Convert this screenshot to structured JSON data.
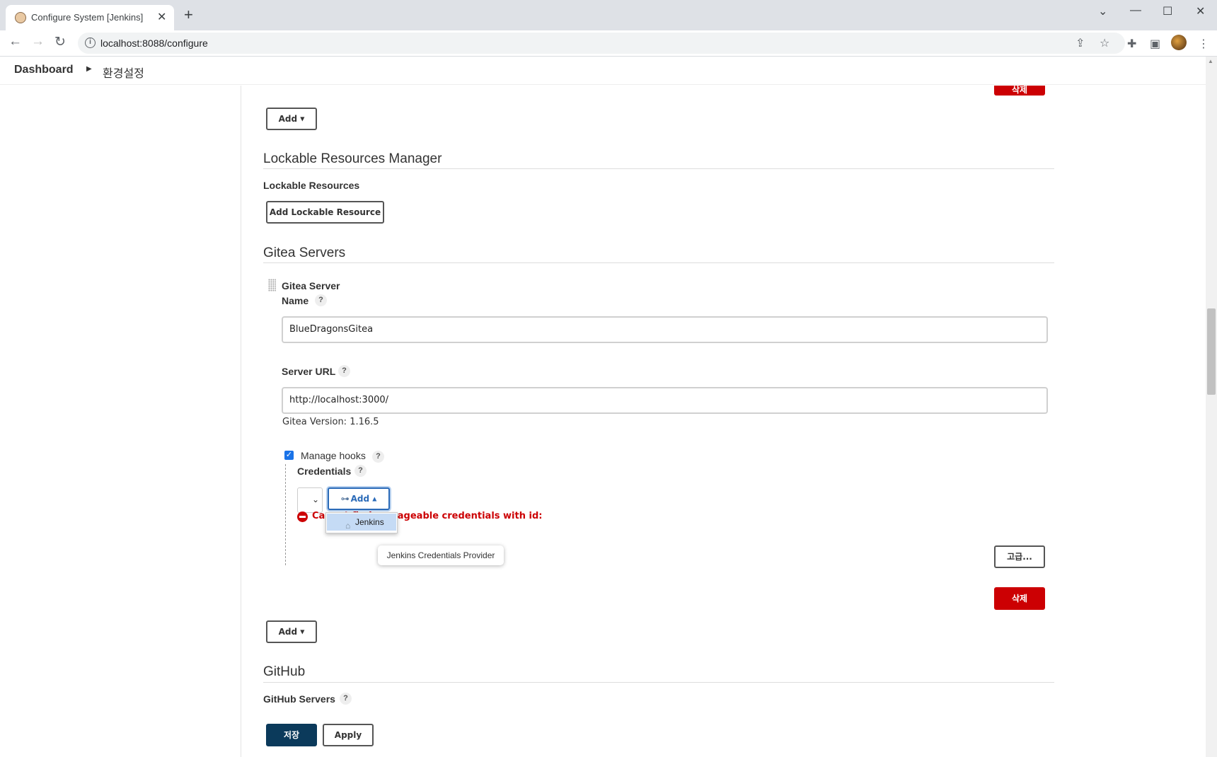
{
  "browser": {
    "tab_title": "Configure System [Jenkins]",
    "tab_close": "✕",
    "new_tab": "+",
    "url": "localhost:8088/configure",
    "window_controls": {
      "dropdown": "⌄",
      "minimize": "—",
      "maximize": "☐",
      "close": "✕"
    }
  },
  "breadcrumb": {
    "home": "Dashboard",
    "separator": "▶",
    "current": "환경설정"
  },
  "top": {
    "delete_label": "삭제",
    "add_label": "Add"
  },
  "lockable": {
    "title": "Lockable Resources Manager",
    "resources_label": "Lockable Resources",
    "add_resource_label": "Add Lockable Resource"
  },
  "gitea": {
    "title": "Gitea Servers",
    "server_label": "Gitea Server",
    "name_label": "Name",
    "name_value": "BlueDragonsGitea",
    "url_label": "Server URL",
    "url_value": "http://localhost:3000/",
    "version_text": "Gitea Version: 1.16.5",
    "manage_hooks_label": "Manage hooks",
    "manage_hooks_checked": true,
    "credentials_label": "Credentials",
    "add_cred_label": "Add",
    "error_text": "Cannot find manageable credentials with id:",
    "dropdown_item": "Jenkins",
    "tooltip": "Jenkins Credentials Provider",
    "advanced_label": "고급...",
    "delete_label": "삭제",
    "add_label": "Add"
  },
  "github": {
    "title": "GitHub",
    "servers_label": "GitHub Servers"
  },
  "footer": {
    "save_label": "저장",
    "apply_label": "Apply"
  },
  "help_glyph": "?"
}
